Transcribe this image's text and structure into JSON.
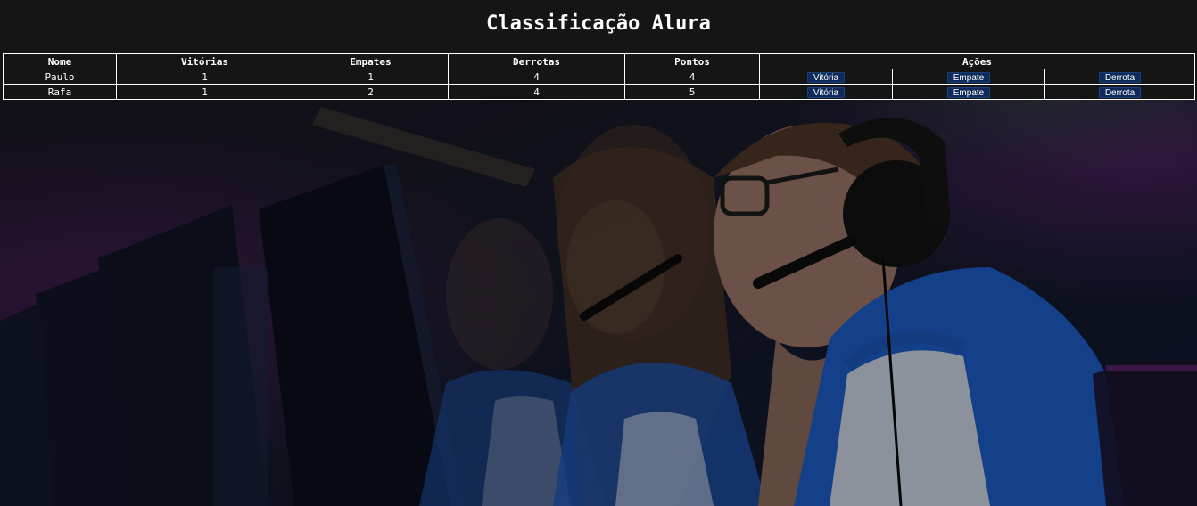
{
  "page": {
    "title": "Classificação Alura"
  },
  "table": {
    "headers": {
      "nome": "Nome",
      "vitorias": "Vitórias",
      "empates": "Empates",
      "derrotas": "Derrotas",
      "pontos": "Pontos",
      "acoes": "Ações"
    },
    "rows": [
      {
        "nome": "Paulo",
        "vitorias": "1",
        "empates": "1",
        "derrotas": "4",
        "pontos": "4",
        "btn_vitoria": "Vitória",
        "btn_empate": "Empate",
        "btn_derrota": "Derrota"
      },
      {
        "nome": "Rafa",
        "vitorias": "1",
        "empates": "2",
        "derrotas": "4",
        "pontos": "5",
        "btn_vitoria": "Vitória",
        "btn_empate": "Empate",
        "btn_derrota": "Derrota"
      }
    ]
  },
  "colors": {
    "background": "#121212",
    "text": "#ffffff",
    "button": "#0e2a5a",
    "photo_tint": "#1a2d6e"
  }
}
